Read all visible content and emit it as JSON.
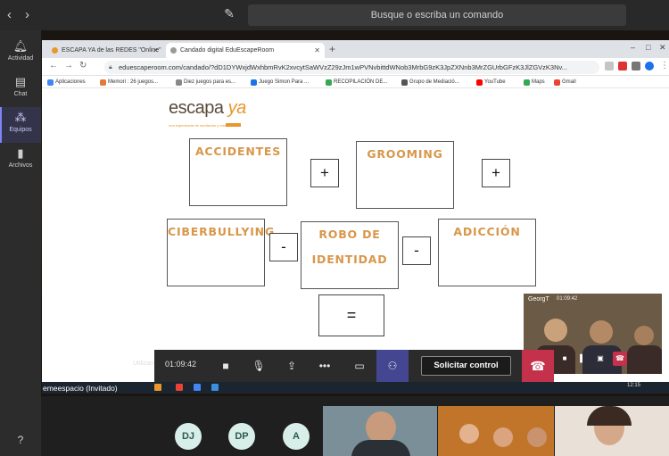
{
  "teams": {
    "search_placeholder": "Busque o escriba un comando",
    "rail": [
      {
        "label": "Actividad",
        "icon": "bell-icon"
      },
      {
        "label": "Chat",
        "icon": "chat-icon"
      },
      {
        "label": "Equipos",
        "icon": "teams-icon"
      },
      {
        "label": "Archivos",
        "icon": "file-icon"
      }
    ],
    "help_label": "Ayuda"
  },
  "browser": {
    "tabs": [
      {
        "title": "ESCAPA YA de las REDES \"Online\"",
        "active": false
      },
      {
        "title": "Candado digital EduEscapeRoom",
        "active": true
      }
    ],
    "url": "eduescaperoom.com/candado/?dD1DYWxjdWxhbmRvK2xvcytSaWVzZ29zJm1wPVNvbittdWNob3MrbG9zK3JpZXNnb3MrZGUrbGFzK3JlZGVzK3Nv...",
    "bookmarks": [
      {
        "label": "Aplicaciones",
        "color": "#4285f4"
      },
      {
        "label": "Memori : 26 juegos...",
        "color": "#e07b39"
      },
      {
        "label": "Diez juegos para es...",
        "color": "#888888"
      },
      {
        "label": "Juego Simon Para ...",
        "color": "#1a73e8"
      },
      {
        "label": "RECOPILACIÓN DE...",
        "color": "#34a853"
      },
      {
        "label": "Grupo de Mediació...",
        "color": "#555555"
      },
      {
        "label": "YouTube",
        "color": "#ff0000"
      },
      {
        "label": "Maps",
        "color": "#34a853"
      },
      {
        "label": "Gmail",
        "color": "#ea4335"
      }
    ]
  },
  "page": {
    "logo_main": "escapa",
    "logo_ya": "ya",
    "logo_sub": "una experiencia de mediación y educación",
    "words": {
      "accidentes": "ACCIDENTES",
      "grooming": "GROOMING",
      "ciberbullying": "CIBERBULLYING",
      "robo_1": "ROBO DE",
      "robo_2": "IDENTIDAD",
      "adiccion": "ADICCIÓN"
    },
    "operators": {
      "plus1": "+",
      "plus2": "+",
      "minus1": "-",
      "minus2": "-",
      "equals": "="
    },
    "label_color": "#d8974a"
  },
  "call": {
    "timer": "01:09:42",
    "request_control": "Solicitar control",
    "utilizan_text": "Utilizan",
    "presenter": "emeespacio (Invitado)",
    "clock": "12:15",
    "pip_name": "GeorgT",
    "pip_time": "01:09:42"
  },
  "participants": {
    "avatars": [
      "DJ",
      "DP",
      "A"
    ]
  },
  "colors": {
    "teams_accent": "#7f85f5",
    "hangup": "#c4314b",
    "orange": "#e8962d"
  }
}
